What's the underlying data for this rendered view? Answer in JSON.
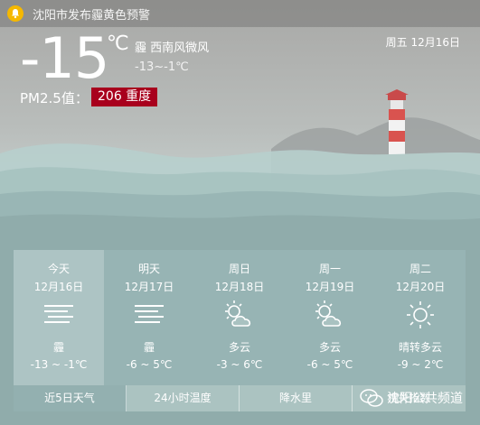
{
  "alert": {
    "text": "沈阳市发布霾黄色预警",
    "icon": "bell-icon",
    "icon_color": "#f5b800"
  },
  "current": {
    "temperature": "-15",
    "unit": "℃",
    "condition": "霾 西南风微风",
    "range": "-13~-1℃",
    "date": "周五 12月16日",
    "pm25_label": "PM2.5值：",
    "pm25_value": "206 重度",
    "pm25_color": "#a8001d"
  },
  "forecast": [
    {
      "name": "今天",
      "date": "12月16日",
      "icon": "haze-icon",
      "weather": "霾",
      "temp": "-13 ~ -1℃"
    },
    {
      "name": "明天",
      "date": "12月17日",
      "icon": "haze-icon",
      "weather": "霾",
      "temp": "-6 ~ 5℃"
    },
    {
      "name": "周日",
      "date": "12月18日",
      "icon": "partly-cloudy-icon",
      "weather": "多云",
      "temp": "-3 ~ 6℃"
    },
    {
      "name": "周一",
      "date": "12月19日",
      "icon": "partly-cloudy-icon",
      "weather": "多云",
      "temp": "-6 ~ 5℃"
    },
    {
      "name": "周二",
      "date": "12月20日",
      "icon": "sun-icon",
      "weather": "晴转多云",
      "temp": "-9 ~ 2℃"
    }
  ],
  "tabs": [
    "近5日天气",
    "24小时温度",
    "降水里",
    "相关指数"
  ],
  "watermark": "沈阳公共频道"
}
